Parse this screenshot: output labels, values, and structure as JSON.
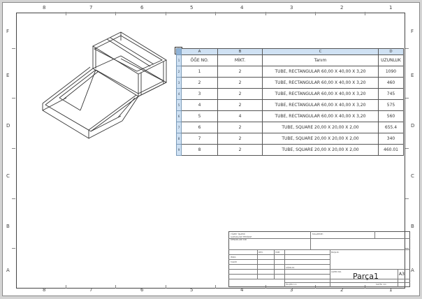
{
  "frame": {
    "columns": [
      "8",
      "7",
      "6",
      "5",
      "4",
      "3",
      "2",
      "1"
    ],
    "rows": [
      "F",
      "E",
      "D",
      "C",
      "B",
      "A"
    ]
  },
  "bom": {
    "column_letters": [
      "A",
      "B",
      "C",
      "D"
    ],
    "headers": [
      "ÖĞE NO.",
      "MİKT.",
      "Tanım",
      "UZUNLUK"
    ],
    "rows": [
      {
        "item": "1",
        "qty": "2",
        "desc": "TUBE, RECTANGULAR 60,00 X 40,00 X 3,20",
        "length": "1090"
      },
      {
        "item": "2",
        "qty": "2",
        "desc": "TUBE, RECTANGULAR 60,00 X 40,00 X 3,20",
        "length": "460"
      },
      {
        "item": "3",
        "qty": "2",
        "desc": "TUBE, RECTANGULAR 60,00 X 40,00 X 3,20",
        "length": "745"
      },
      {
        "item": "4",
        "qty": "2",
        "desc": "TUBE, RECTANGULAR 60,00 X 40,00 X 3,20",
        "length": "575"
      },
      {
        "item": "5",
        "qty": "4",
        "desc": "TUBE, RECTANGULAR 60,00 X 40,00 X 3,20",
        "length": "560"
      },
      {
        "item": "6",
        "qty": "2",
        "desc": "TUBE, SQUARE 20,00 X 20,00 X 2,00",
        "length": "655.4"
      },
      {
        "item": "7",
        "qty": "2",
        "desc": "TUBE, SQUARE 20,00 X 20,00 X 2,00",
        "length": "340"
      },
      {
        "item": "8",
        "qty": "2",
        "desc": "TUBE, SQUARE 20,00 X 20,00 X 2,00",
        "length": "460.01"
      }
    ],
    "row_numbers": [
      "1",
      "2",
      "3",
      "4",
      "5",
      "6",
      "7",
      "8",
      "9",
      "10"
    ]
  },
  "title_block": {
    "part_name": "Parça1",
    "sheet_size": "A3",
    "small_texts": [
      "YÜZEY İŞLEMİ",
      "ÇAPAKLARI TEMİZLE",
      "KENARLARI KIR",
      "REV.",
      "İSİM",
      "İMZA",
      "TARİH",
      "BAŞLIK:",
      "ÇİZİM NO.",
      "ÖLÇEK:1:1",
      "SAYFA 1/1",
      "AĞIRLIK:",
      "MALZEME:"
    ]
  }
}
